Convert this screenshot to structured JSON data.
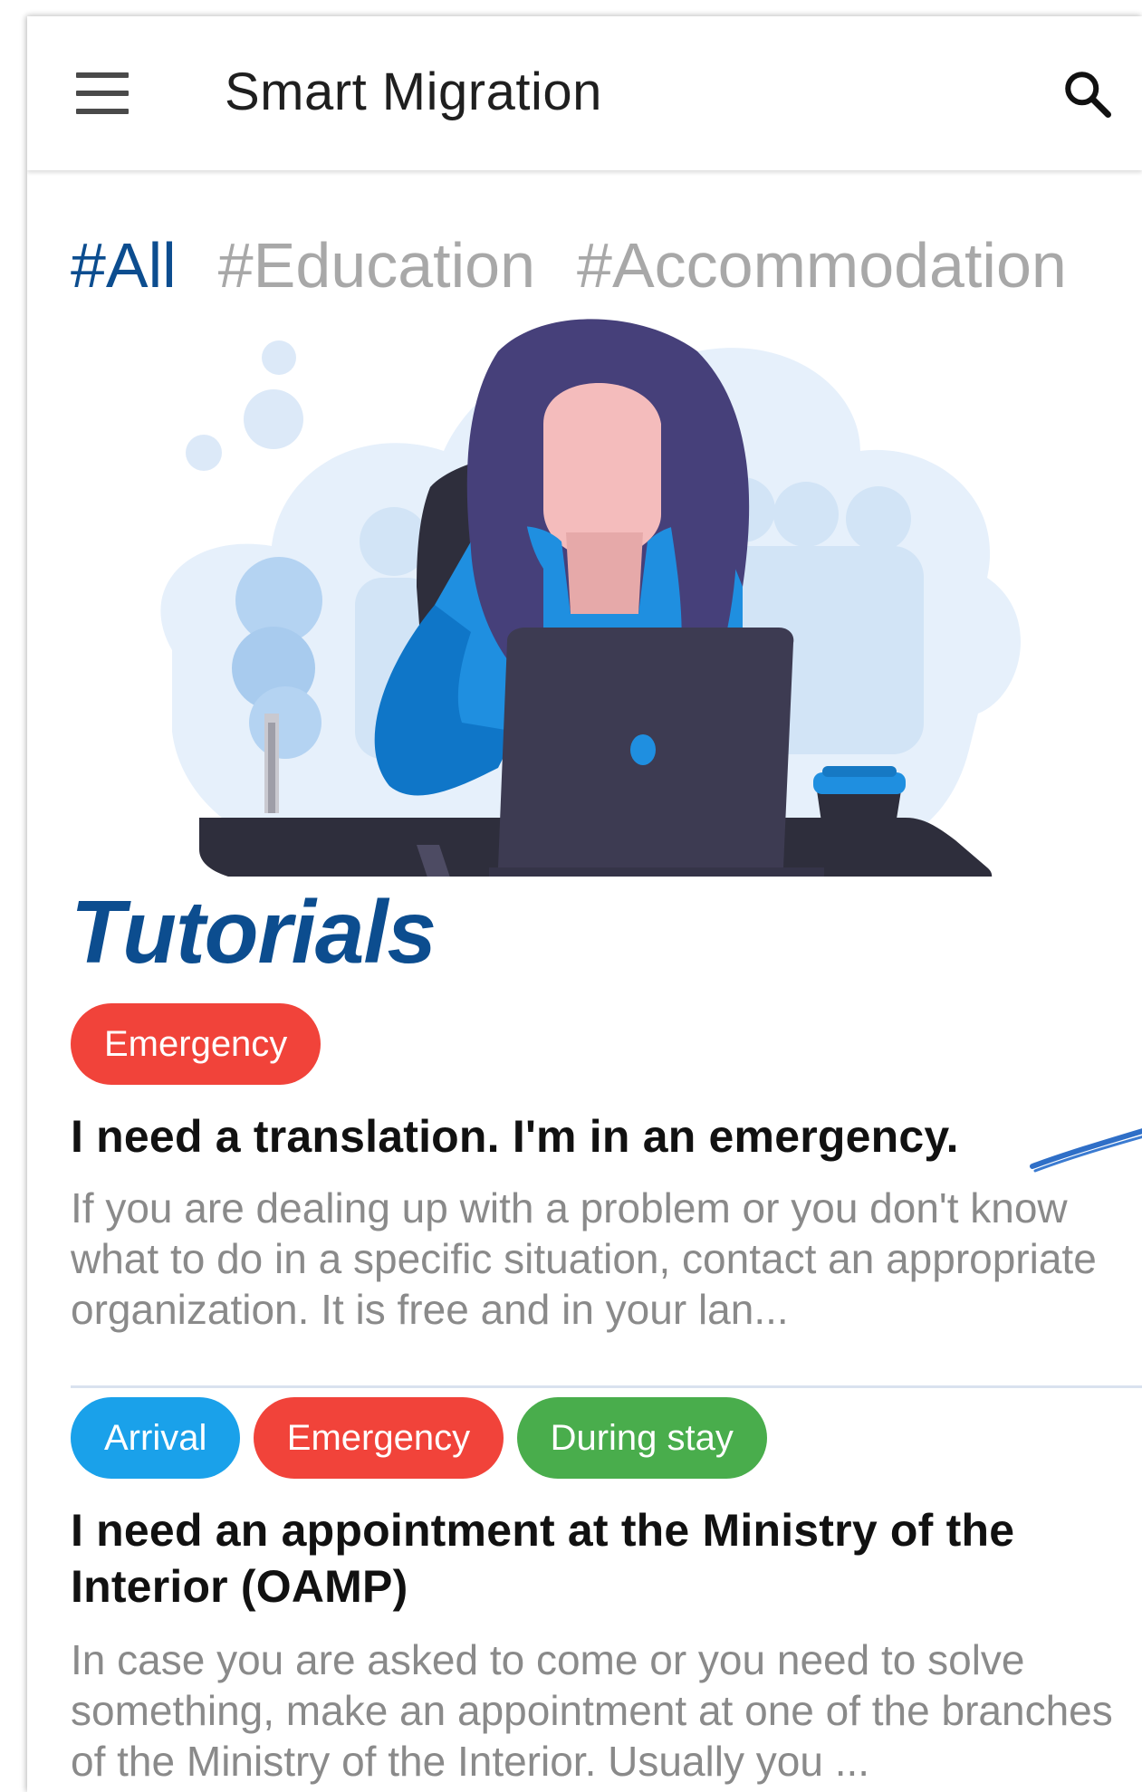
{
  "header": {
    "title": "Smart Migration",
    "menu_icon": "menu-icon",
    "search_icon": "search-icon"
  },
  "tabs": [
    {
      "label": "#All",
      "active": true
    },
    {
      "label": "#Education",
      "active": false
    },
    {
      "label": "#Accommodation",
      "active": false
    }
  ],
  "section": {
    "title": "Tutorials"
  },
  "illustration": {
    "icon": "woman-at-laptop-illustration"
  },
  "colors": {
    "accent": "#0c4d8f",
    "tag_emergency": "#f1433a",
    "tag_arrival": "#1aa1ea",
    "tag_during_stay": "#49ad4c"
  },
  "cards": [
    {
      "tags": [
        "Emergency"
      ],
      "title": "I need a translation. I'm in an emergency.",
      "body": "If you are dealing up with a problem or you don't know what to do in a specific situation, contact an appropriate organization. It is free and in your lan..."
    },
    {
      "tags": [
        "Arrival",
        "Emergency",
        "During stay"
      ],
      "title": "I need an appointment at the Ministry of the Interior (OAMP)",
      "body": "In case you are asked to come or you need to solve something, make an appointment at one of the branches of the Ministry of the Interior. Usually you ..."
    }
  ]
}
